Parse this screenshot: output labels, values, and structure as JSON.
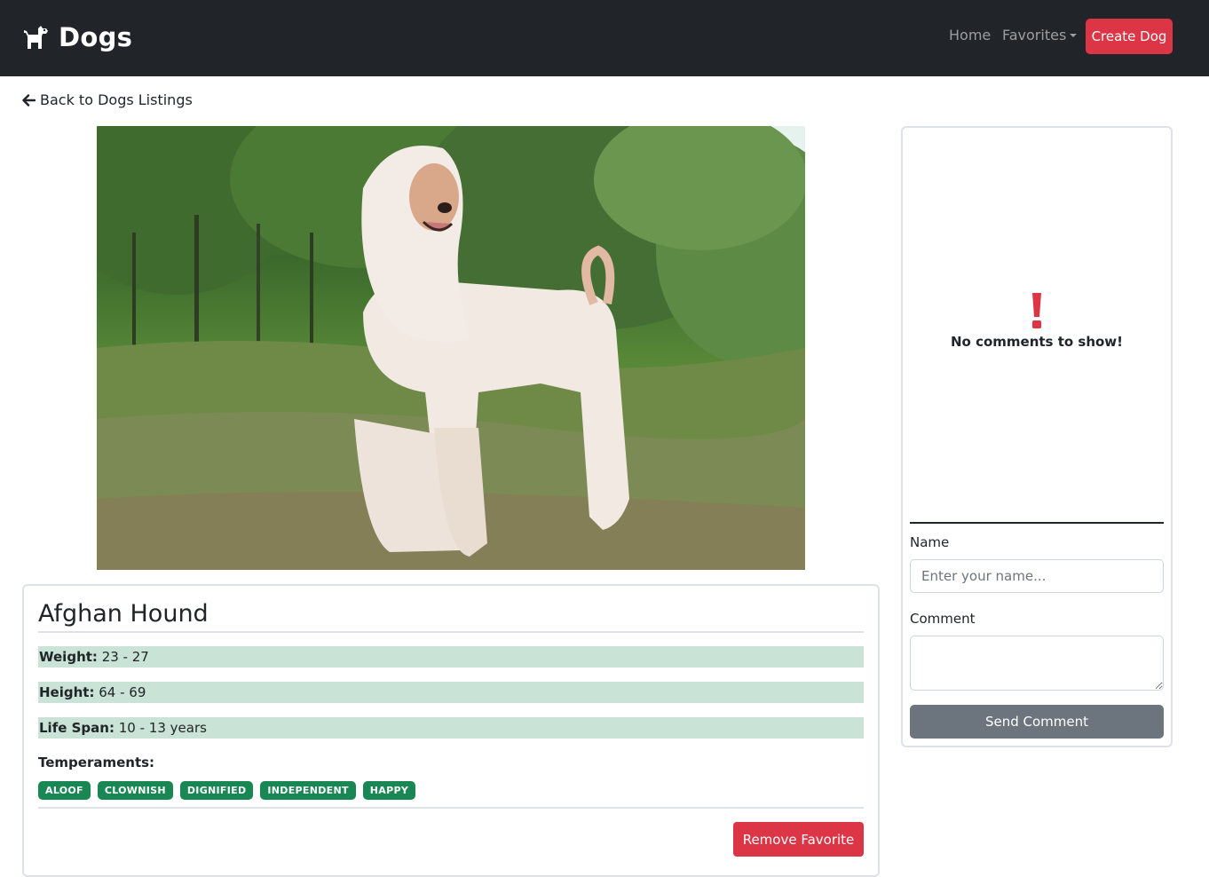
{
  "navbar": {
    "brand": "Dogs",
    "brand_icon": "dog-icon",
    "links": {
      "home": "Home",
      "favorites": "Favorites"
    },
    "create_button": "Create Dog",
    "colors": {
      "background": "#212529",
      "create": "#dc3545"
    }
  },
  "back_link": {
    "icon": "arrow-left-icon",
    "label": "Back to Dogs Listings"
  },
  "dog": {
    "image": {
      "subject": "dog-photo"
    },
    "name": "Afghan Hound",
    "attributes": {
      "weight_label": "Weight:",
      "weight_value": "23 - 27",
      "height_label": "Height:",
      "height_value": "64 - 69",
      "life_span_label": "Life Span:",
      "life_span_value": "10 - 13 years"
    },
    "temperaments_label": "Temperaments:",
    "temperaments": [
      "ALOOF",
      "CLOWNISH",
      "DIGNIFIED",
      "INDEPENDENT",
      "HAPPY"
    ],
    "remove_favorite": "Remove Favorite"
  },
  "comments": {
    "empty_icon": "exclamation-icon",
    "empty_text": "No comments to show!",
    "name_label": "Name",
    "name_placeholder": "Enter your name...",
    "name_value": "",
    "comment_label": "Comment",
    "comment_value": "",
    "send_button": "Send Comment"
  },
  "colors": {
    "attr_row": "#c9e3d6",
    "badge": "#198754",
    "remove": "#dc3545",
    "send": "#6c757d",
    "alert": "#dc3545"
  }
}
